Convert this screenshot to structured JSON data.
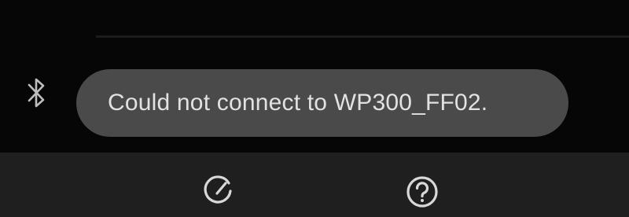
{
  "toast": {
    "message": "Could not connect to WP300_FF02."
  },
  "icons": {
    "status": "bluetooth-icon",
    "bottom_left": "refresh-icon",
    "bottom_right": "help-icon"
  },
  "colors": {
    "background": "#060606",
    "toast_background": "#4a4a4a",
    "toast_text": "#e2e2e2",
    "bottom_bar": "#1f1f1f",
    "icon": "#d8d8d8"
  }
}
